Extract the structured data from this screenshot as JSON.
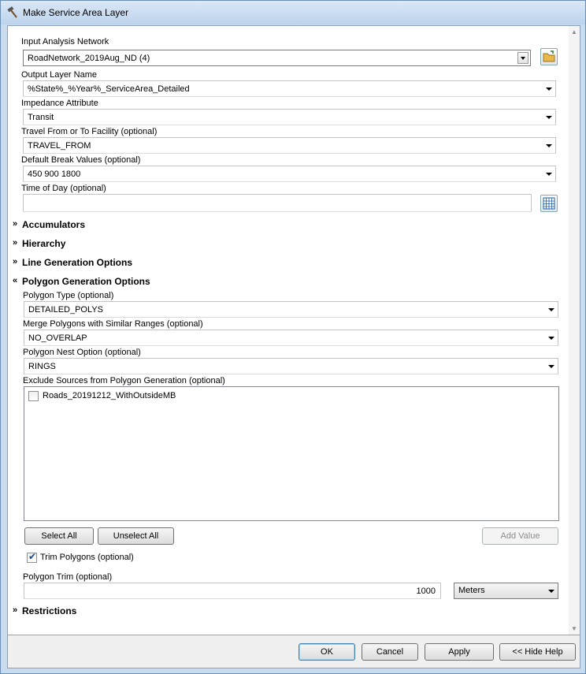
{
  "window": {
    "title": "Make Service Area Layer"
  },
  "fields": {
    "network": {
      "label": "Input Analysis Network",
      "value": "RoadNetwork_2019Aug_ND (4)"
    },
    "output_layer": {
      "label": "Output Layer Name",
      "value": "%State%_%Year%_ServiceArea_Detailed"
    },
    "impedance": {
      "label": "Impedance Attribute",
      "value": "Transit"
    },
    "travel_from_to": {
      "label": "Travel From or To Facility (optional)",
      "value": "TRAVEL_FROM"
    },
    "break_values": {
      "label": "Default Break Values (optional)",
      "value": "450 900 1800"
    },
    "time_of_day": {
      "label": "Time of Day (optional)",
      "value": ""
    }
  },
  "sections": {
    "accumulators": "Accumulators",
    "hierarchy": "Hierarchy",
    "line_generation": "Line Generation Options",
    "polygon_generation": "Polygon Generation Options",
    "restrictions": "Restrictions"
  },
  "polygon": {
    "type": {
      "label": "Polygon Type (optional)",
      "value": "DETAILED_POLYS"
    },
    "merge": {
      "label": "Merge Polygons with Similar Ranges (optional)",
      "value": "NO_OVERLAP"
    },
    "nest": {
      "label": "Polygon Nest Option (optional)",
      "value": "RINGS"
    },
    "exclude": {
      "label": "Exclude Sources from Polygon Generation (optional)",
      "items": [
        {
          "label": "Roads_20191212_WithOutsideMB",
          "checked": false
        }
      ]
    },
    "select_all": "Select All",
    "unselect_all": "Unselect All",
    "add_value": "Add Value",
    "trim_checkbox": {
      "label": "Trim Polygons (optional)",
      "checked": true
    },
    "trim": {
      "label": "Polygon Trim (optional)",
      "value": "1000",
      "unit": "Meters"
    }
  },
  "footer": {
    "ok": "OK",
    "cancel": "Cancel",
    "apply": "Apply",
    "hide_help": "<< Hide Help"
  },
  "icons": {
    "title": "hammer-icon",
    "browse": "open-folder-icon",
    "time_picker": "calendar-grid-icon"
  }
}
